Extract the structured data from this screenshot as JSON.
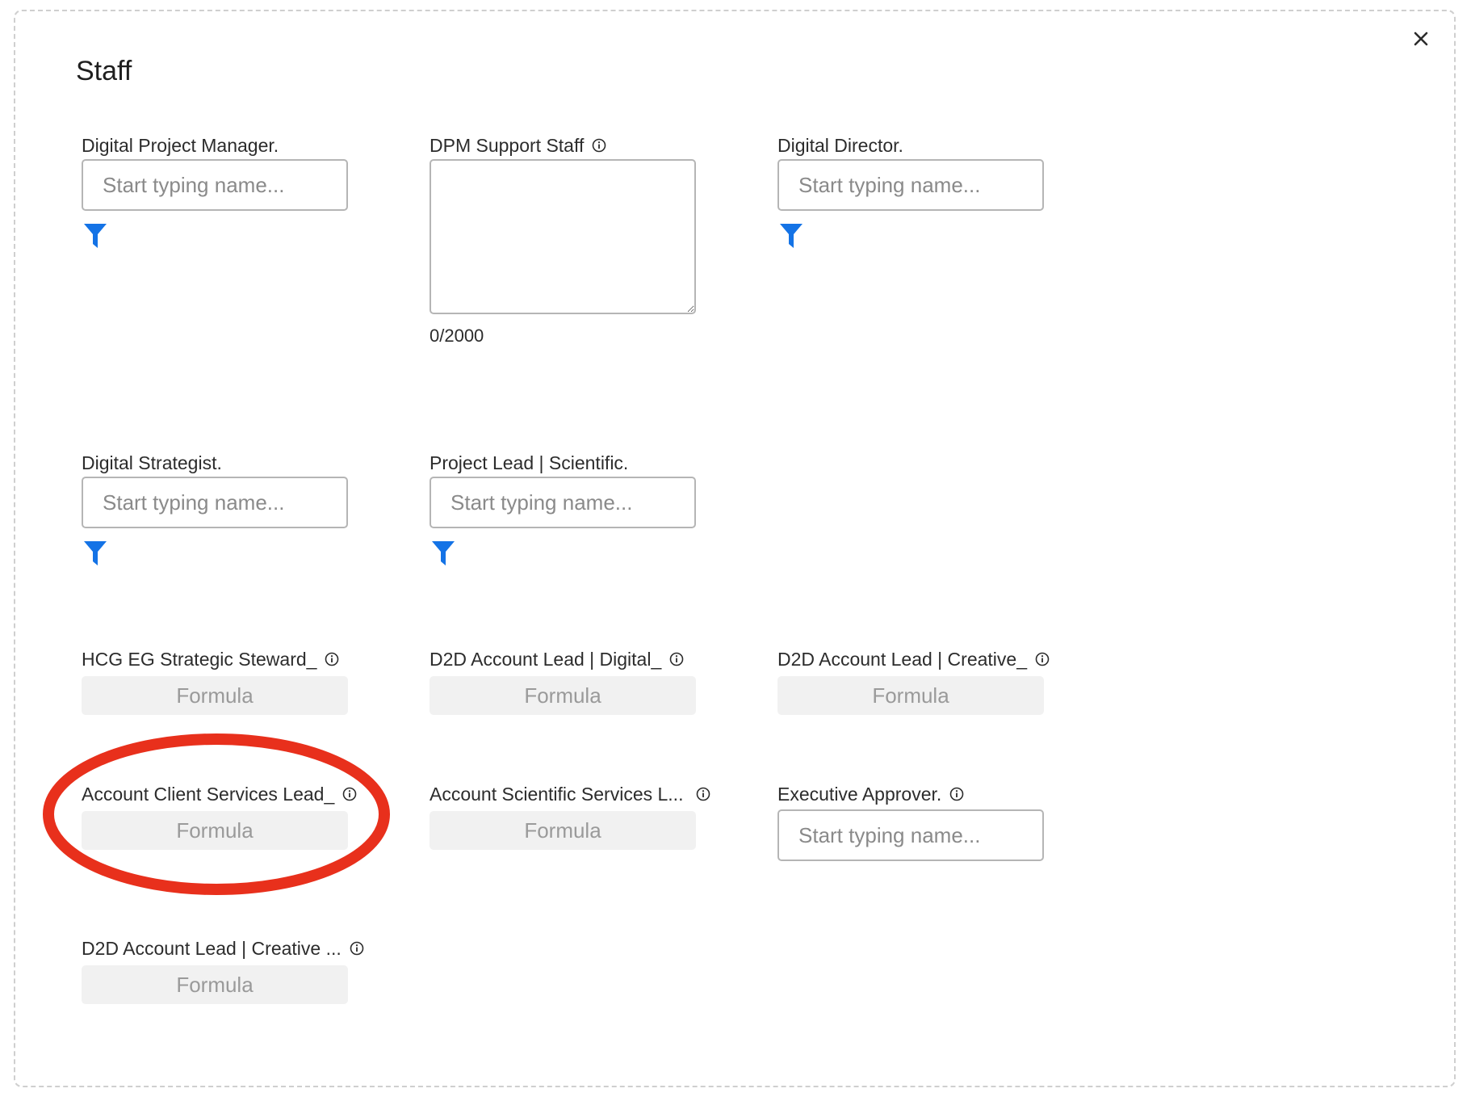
{
  "dialog": {
    "title": "Staff",
    "close_icon": "close-icon"
  },
  "fields": {
    "digital_project_manager": {
      "label": "Digital Project Manager.",
      "placeholder": "Start typing name...",
      "value": ""
    },
    "dpm_support_staff": {
      "label": "DPM Support Staff",
      "value": "",
      "counter": "0/2000"
    },
    "digital_director": {
      "label": "Digital Director.",
      "placeholder": "Start typing name...",
      "value": ""
    },
    "digital_strategist": {
      "label": "Digital Strategist.",
      "placeholder": "Start typing name...",
      "value": ""
    },
    "project_lead_scientific": {
      "label": "Project Lead | Scientific.",
      "placeholder": "Start typing name...",
      "value": ""
    },
    "hcg_eg_strategic_steward": {
      "label": "HCG EG Strategic Steward_",
      "formula": "Formula"
    },
    "d2d_account_lead_digital": {
      "label": "D2D Account Lead | Digital_",
      "formula": "Formula"
    },
    "d2d_account_lead_creative": {
      "label": "D2D Account Lead | Creative_",
      "formula": "Formula"
    },
    "account_client_services_lead": {
      "label": "Account Client Services Lead_",
      "formula": "Formula"
    },
    "account_scientific_services_lead": {
      "label": "Account Scientific Services L...",
      "formula": "Formula"
    },
    "executive_approver": {
      "label": "Executive Approver.",
      "placeholder": "Start typing name...",
      "value": ""
    },
    "d2d_account_lead_creative_2": {
      "label": "D2D Account Lead | Creative ...",
      "formula": "Formula"
    }
  },
  "colors": {
    "filter_icon": "#1473e6",
    "annotation": "#e8301c",
    "input_border": "#b5b5b5",
    "formula_bg": "#f1f1f1"
  },
  "icons": {
    "filter": "filter-icon",
    "info": "info-icon"
  }
}
